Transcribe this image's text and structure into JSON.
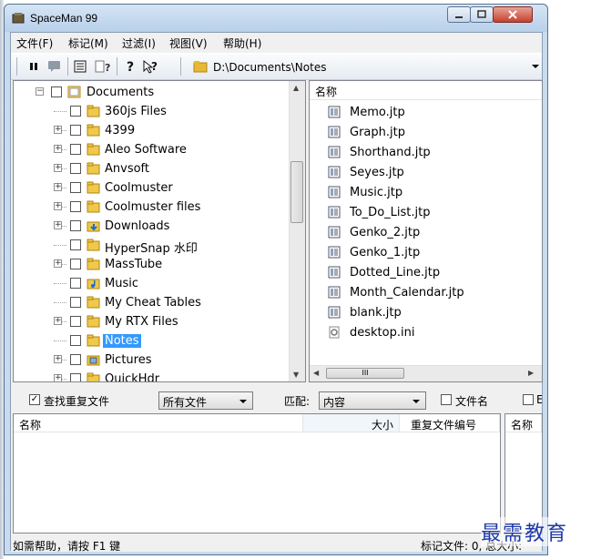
{
  "window": {
    "title": "SpaceMan 99",
    "controls": {
      "minimize": "minimize",
      "maximize": "maximize",
      "close": "close"
    }
  },
  "menu": [
    {
      "label": "文件(F)"
    },
    {
      "label": "标记(M)"
    },
    {
      "label": "过滤(I)"
    },
    {
      "label": "视图(V)"
    },
    {
      "label": "帮助(H)"
    }
  ],
  "toolbar": {
    "path": "D:\\Documents\\Notes"
  },
  "tree": {
    "root": "Documents",
    "items": [
      {
        "label": "360js Files",
        "expander": false
      },
      {
        "label": "4399",
        "expander": true
      },
      {
        "label": "Aleo Software",
        "expander": true
      },
      {
        "label": "Anvsoft",
        "expander": true
      },
      {
        "label": "Coolmuster",
        "expander": true
      },
      {
        "label": "Coolmuster files",
        "expander": true
      },
      {
        "label": "Downloads",
        "expander": true
      },
      {
        "label": "HyperSnap 水印",
        "expander": false
      },
      {
        "label": "MassTube",
        "expander": true
      },
      {
        "label": "Music",
        "expander": false
      },
      {
        "label": "My Cheat Tables",
        "expander": false
      },
      {
        "label": "My RTX Files",
        "expander": true
      },
      {
        "label": "Notes",
        "expander": false,
        "selected": true
      },
      {
        "label": "Pictures",
        "expander": true
      },
      {
        "label": "QuickHdr",
        "expander": true
      }
    ]
  },
  "filelist": {
    "header": "名称",
    "files": [
      "Memo.jtp",
      "Graph.jtp",
      "Shorthand.jtp",
      "Seyes.jtp",
      "Music.jtp",
      "To_Do_List.jtp",
      "Genko_2.jtp",
      "Genko_1.jtp",
      "Dotted_Line.jtp",
      "Month_Calendar.jtp",
      "blank.jtp",
      "desktop.ini"
    ],
    "hscroll_grip": "III"
  },
  "find": {
    "check_label": "查找重复文件",
    "filter_value": "所有文件",
    "match_label": "匹配:",
    "match_value": "内容",
    "filename_label": "文件名",
    "extra_label": "E"
  },
  "dup_columns": {
    "name": "名称",
    "size": "大小",
    "dup_id": "重复文件编号",
    "name2": "名称"
  },
  "status": {
    "left": "如需帮助，请按 F1 键",
    "right": "标记文件: 0,  总大小:"
  },
  "watermark": "最需教育"
}
